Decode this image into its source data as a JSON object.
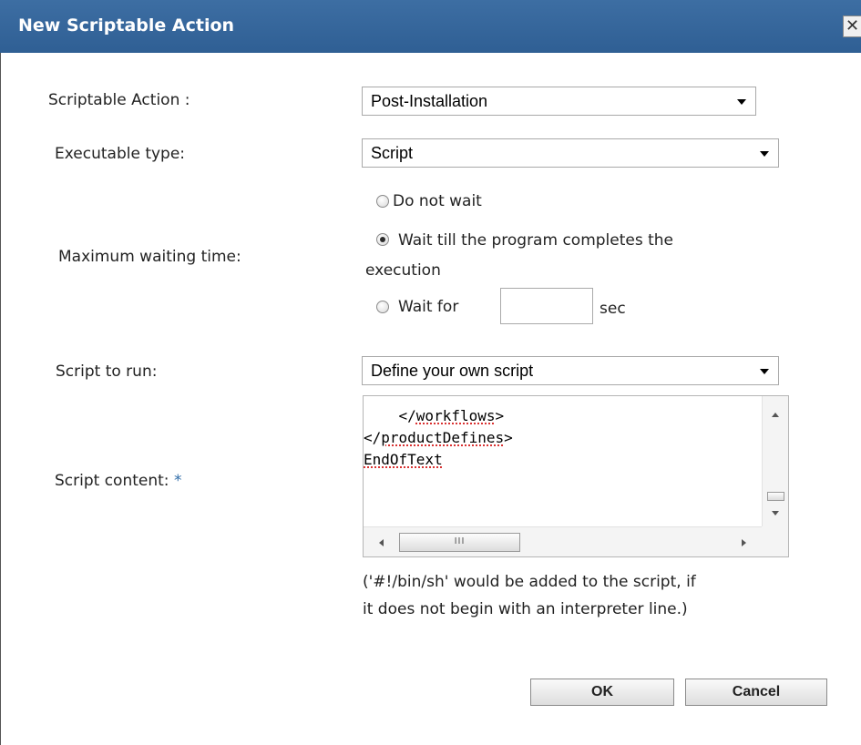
{
  "dialog": {
    "title": "New Scriptable Action",
    "close_glyph": "✕"
  },
  "fields": {
    "scriptable_action": {
      "label": "Scriptable Action :",
      "value": "Post-Installation"
    },
    "executable_type": {
      "label": "Executable type:",
      "value": "Script"
    },
    "max_wait": {
      "label": "Maximum waiting time:",
      "options": {
        "do_not_wait": "Do not wait",
        "wait_completes_line1": "Wait till the program completes the",
        "wait_completes_line2": "execution",
        "wait_for": "Wait for",
        "wait_for_unit": "sec"
      },
      "wait_for_value": "",
      "selected": "wait_completes"
    },
    "script_to_run": {
      "label": "Script to run:",
      "value": "Define your own script"
    },
    "script_content": {
      "label": "Script content: ",
      "required_marker": "*",
      "lines": {
        "l1_indent": "    ",
        "l1_prefix": "</",
        "l1_word": "workflows",
        "l1_suffix": ">",
        "l2_prefix": "</",
        "l2_word": "productDefines",
        "l2_suffix": ">",
        "l3_word": "EndOfText"
      },
      "hscroll_grip": "III"
    },
    "note_line1": "('#!/bin/sh' would be added to the script, if",
    "note_line2": "it does not begin with an interpreter line.)"
  },
  "buttons": {
    "ok": "OK",
    "cancel": "Cancel"
  },
  "icons": {
    "close": "close-icon",
    "dropdown": "chevron-down-icon",
    "scroll_up": "arrow-up-icon",
    "scroll_down": "arrow-down-icon",
    "scroll_left": "arrow-left-icon",
    "scroll_right": "arrow-right-icon"
  },
  "colors": {
    "titlebar": "#3d6ea3",
    "required_asterisk": "#2f6ca8",
    "spellcheck_underline": "#d00000"
  }
}
